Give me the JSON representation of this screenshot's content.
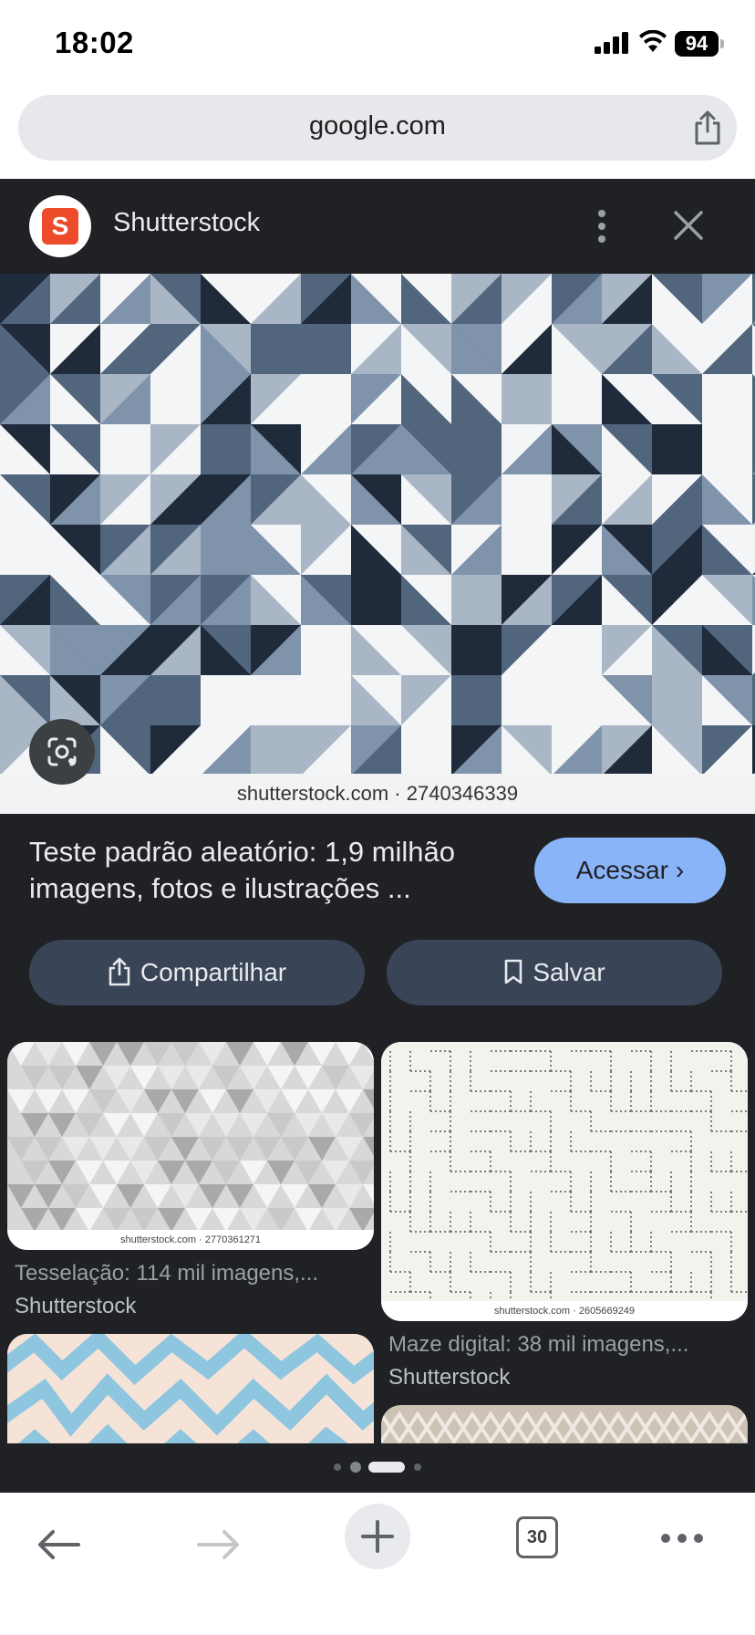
{
  "status_bar": {
    "time": "18:02",
    "battery": "94"
  },
  "address_bar": {
    "url": "google.com"
  },
  "viewer": {
    "source_name": "Shutterstock",
    "image_caption": "shutterstock.com · 2740346339",
    "title": "Teste padrão aleatório: 1,9 milhão imagens, fotos e ilustrações ...",
    "visit_label": "Acessar",
    "share_label": "Compartilhar",
    "save_label": "Salvar"
  },
  "related": [
    {
      "caption": "shutterstock.com · 2770361271",
      "title": "Tesselação: 114 mil imagens,...",
      "source": "Shutterstock"
    },
    {
      "caption": "shutterstock.com · 2605669249",
      "title": "Maze digital: 38 mil imagens,...",
      "source": "Shutterstock"
    }
  ],
  "toolbar": {
    "tab_count": "30"
  },
  "colors": {
    "viewer_bg": "#202124",
    "accent": "#8ab4f8",
    "button_bg": "#394457"
  }
}
